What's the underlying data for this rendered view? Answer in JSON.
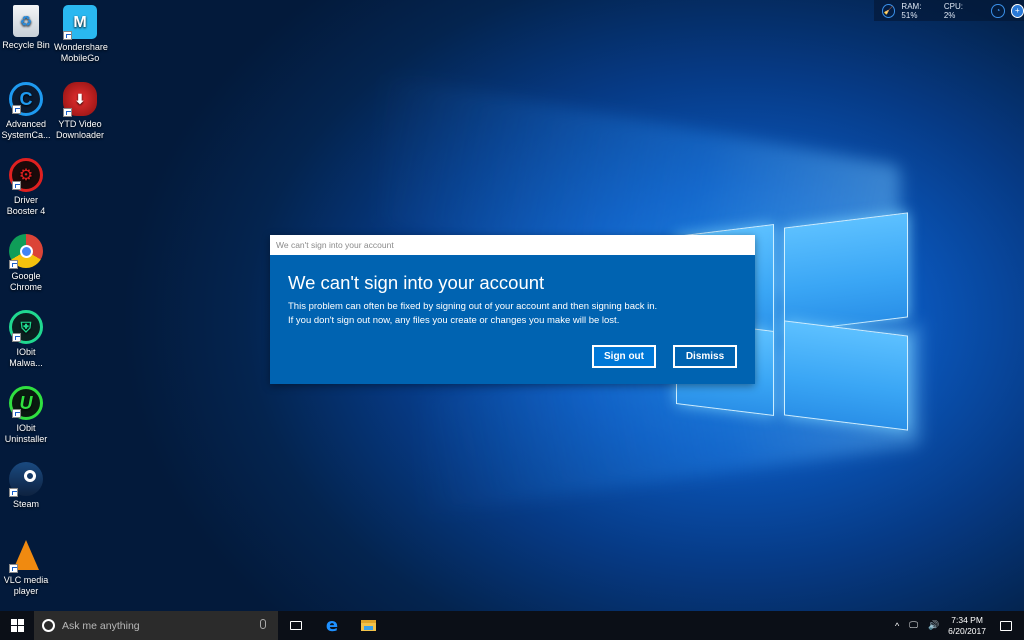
{
  "desktop": {
    "icons": [
      {
        "label": "Recycle Bin",
        "icon": "recycle-bin-icon",
        "shortcut": false
      },
      {
        "label": "Wondershare MobileGo",
        "icon": "mobilego-icon",
        "shortcut": true
      },
      {
        "label": "Advanced SystemCa...",
        "icon": "advanced-systemcare-icon",
        "shortcut": true
      },
      {
        "label": "YTD Video Downloader",
        "icon": "ytd-video-downloader-icon",
        "shortcut": true
      },
      {
        "label": "Driver Booster 4",
        "icon": "driver-booster-icon",
        "shortcut": true
      },
      {
        "label": "Google Chrome",
        "icon": "chrome-icon",
        "shortcut": true
      },
      {
        "label": "IObit Malwa...",
        "icon": "iobit-malware-fighter-icon",
        "shortcut": true
      },
      {
        "label": "IObit Uninstaller",
        "icon": "iobit-uninstaller-icon",
        "shortcut": true
      },
      {
        "label": "Steam",
        "icon": "steam-icon",
        "shortcut": true
      },
      {
        "label": "VLC media player",
        "icon": "vlc-icon",
        "shortcut": true
      }
    ]
  },
  "sysmon": {
    "ram_label": "RAM: 51%",
    "cpu_label": "CPU: 2%"
  },
  "dialog": {
    "window_title": "We can't sign into your account",
    "heading": "We can't sign into your account",
    "line1": "This problem can often be fixed by signing out of your account and then signing back in.",
    "line2": "If you don't sign out now, any files you create or changes you make will be lost.",
    "sign_out_label": "Sign out",
    "dismiss_label": "Dismiss",
    "accent_color": "#0063b1"
  },
  "taskbar": {
    "search_placeholder": "Ask me anything",
    "time": "7:34 PM",
    "date": "6/20/2017"
  }
}
